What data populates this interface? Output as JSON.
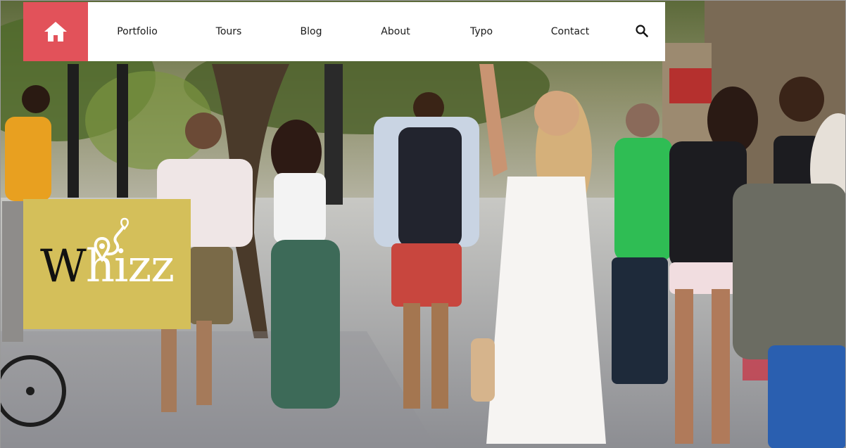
{
  "nav": {
    "home_icon": "home-icon",
    "items": [
      {
        "label": "Portfolio"
      },
      {
        "label": "Tours"
      },
      {
        "label": "Blog"
      },
      {
        "label": "About"
      },
      {
        "label": "Typo"
      },
      {
        "label": "Contact"
      }
    ],
    "search_icon": "search-icon"
  },
  "logo": {
    "first_letter": "W",
    "rest": "hizz",
    "mark_icon": "location-pin-icon"
  },
  "colors": {
    "home_button": "#e2525a",
    "logo_background": "#d4bf5a",
    "nav_background": "#ffffff"
  }
}
